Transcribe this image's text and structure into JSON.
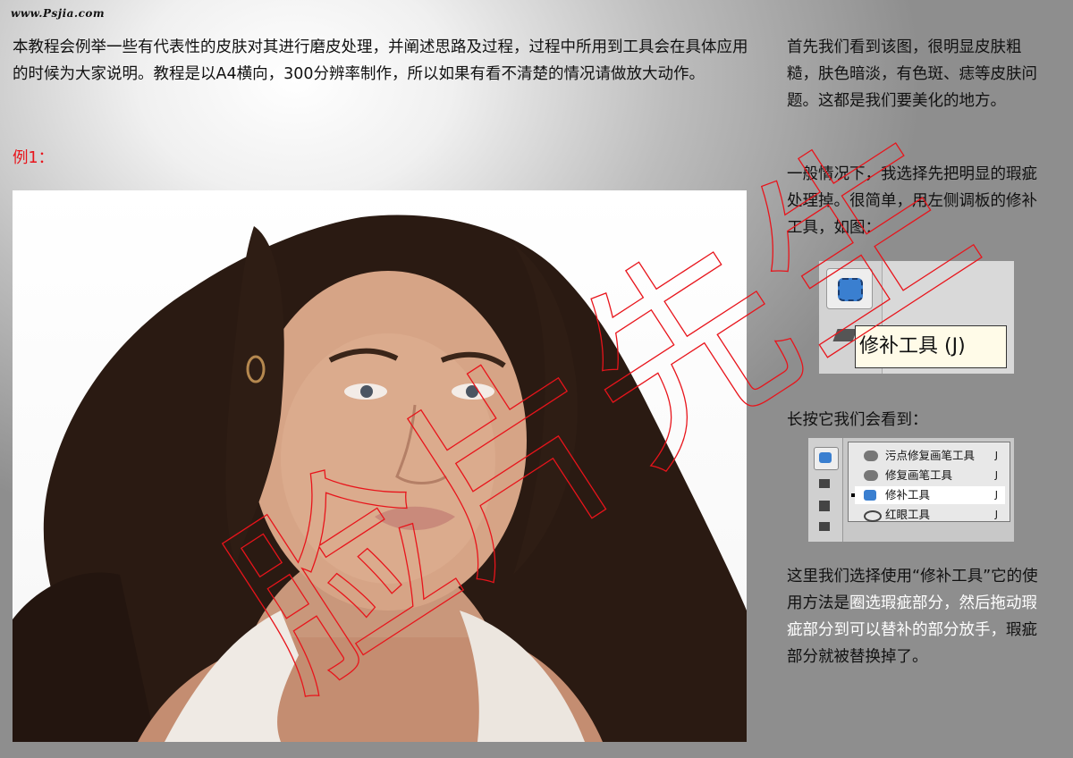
{
  "site": "www.Psjia.com",
  "intro": "本教程会例举一些有代表性的皮肤对其进行磨皮处理，并阐述思路及过程，过程中所用到工具会在具体应用的时候为大家说明。教程是以A4横向，300分辨率制作，所以如果有看不清楚的情况请做放大动作。",
  "example_label": "例1：",
  "right": {
    "p1": "首先我们看到该图，很明显皮肤粗糙，肤色暗淡，有色斑、痣等皮肤问题。这都是我们要美化的地方。",
    "p2": "一般情况下，我选择先把明显的瑕疵处理掉。很简单，用左侧调板的修补工具，如图：",
    "p3": "长按它我们会看到：",
    "p4a": "这里我们选择使用“修补工具”它的使用方法是",
    "p4b": "圈选瑕疵部分，然后拖动瑕疵部分到可以替补的部分放手，",
    "p4c": "瑕疵部分就被替换掉了。"
  },
  "tooltip": "修补工具 (J)",
  "menu": [
    {
      "label": "污点修复画笔工具",
      "key": "J",
      "icon": "spot-healing-brush-icon"
    },
    {
      "label": "修复画笔工具",
      "key": "J",
      "icon": "healing-brush-icon"
    },
    {
      "label": "修补工具",
      "key": "J",
      "icon": "patch-icon",
      "selected": true
    },
    {
      "label": "红眼工具",
      "key": "J",
      "icon": "red-eye-icon"
    }
  ],
  "watermark": "脸片先生"
}
